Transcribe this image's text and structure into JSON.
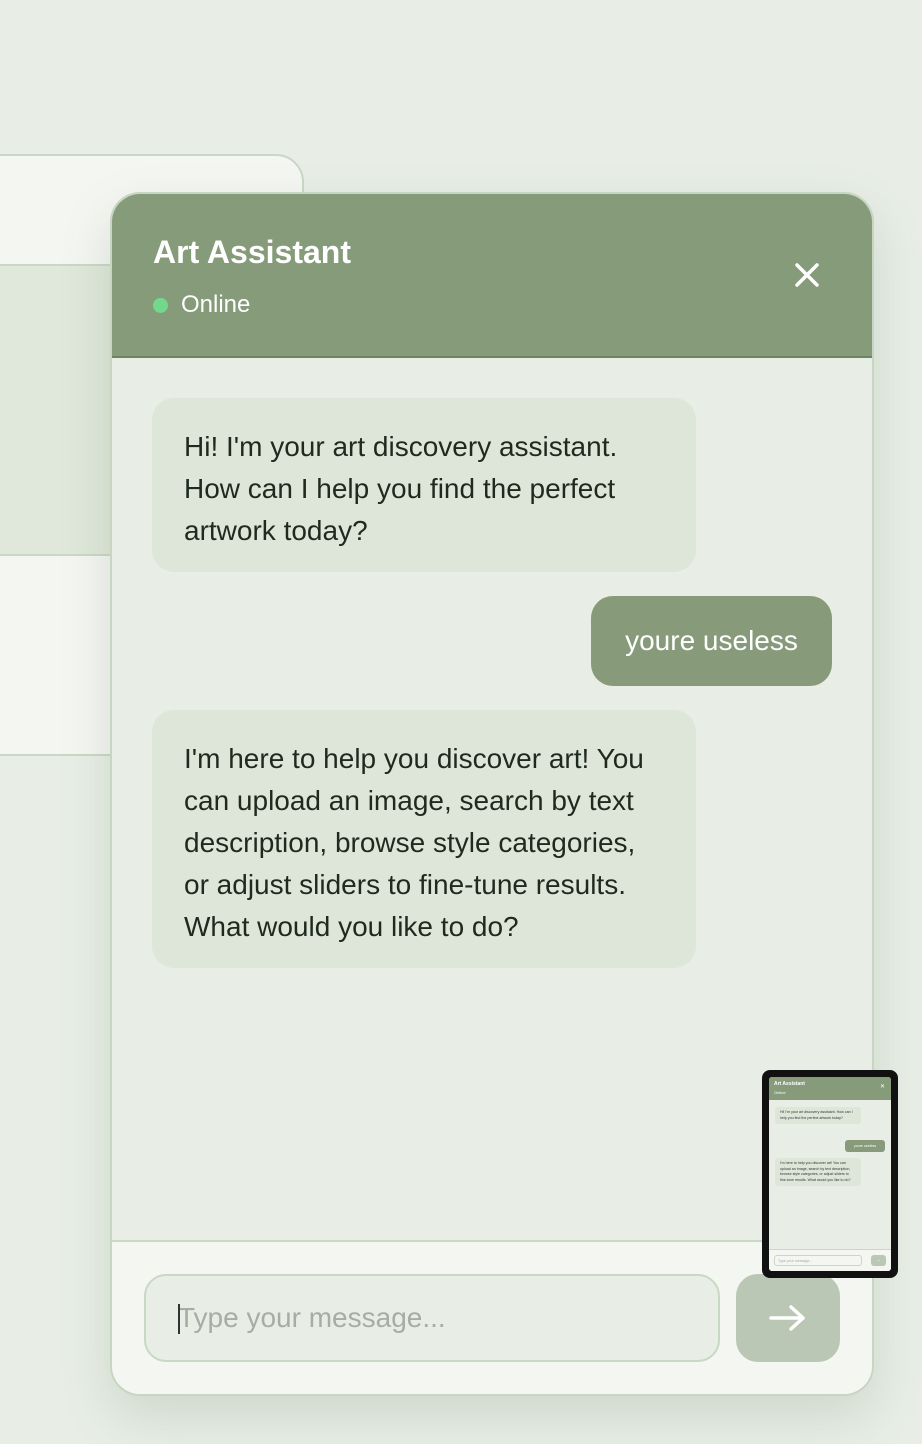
{
  "chat": {
    "title": "Art Assistant",
    "status": "Online",
    "close_icon": "close-icon",
    "messages": [
      {
        "role": "assistant",
        "text": "Hi! I'm your art discovery assistant. How can I help you find the perfect artwork today?"
      },
      {
        "role": "user",
        "text": "youre useless"
      },
      {
        "role": "assistant",
        "text": "I'm here to help you discover art! You can upload an image, search by text description, browse style categories, or adjust sliders to fine-tune results. What would you like to do?"
      }
    ],
    "input": {
      "value": "",
      "placeholder": "Type your message..."
    },
    "send_icon": "arrow-right-icon"
  },
  "thumbnail": {
    "title": "Art Assistant",
    "status": "Online",
    "messages": [
      "Hi! I'm your art discovery assistant. How can I help you find the perfect artwork today?",
      "youre useless",
      "I'm here to help you discover art! You can upload an image, search by text description, browse style categories, or adjust sliders to fine-tune results. What would you like to do?"
    ],
    "input_placeholder": "Type your message..."
  },
  "colors": {
    "header": "#869b7a",
    "user_bubble": "#879b7b",
    "assistant_bubble": "#dde6d8",
    "online_dot": "#74d88c",
    "send_button": "#bbc7b5",
    "background": "#e8eee6"
  }
}
